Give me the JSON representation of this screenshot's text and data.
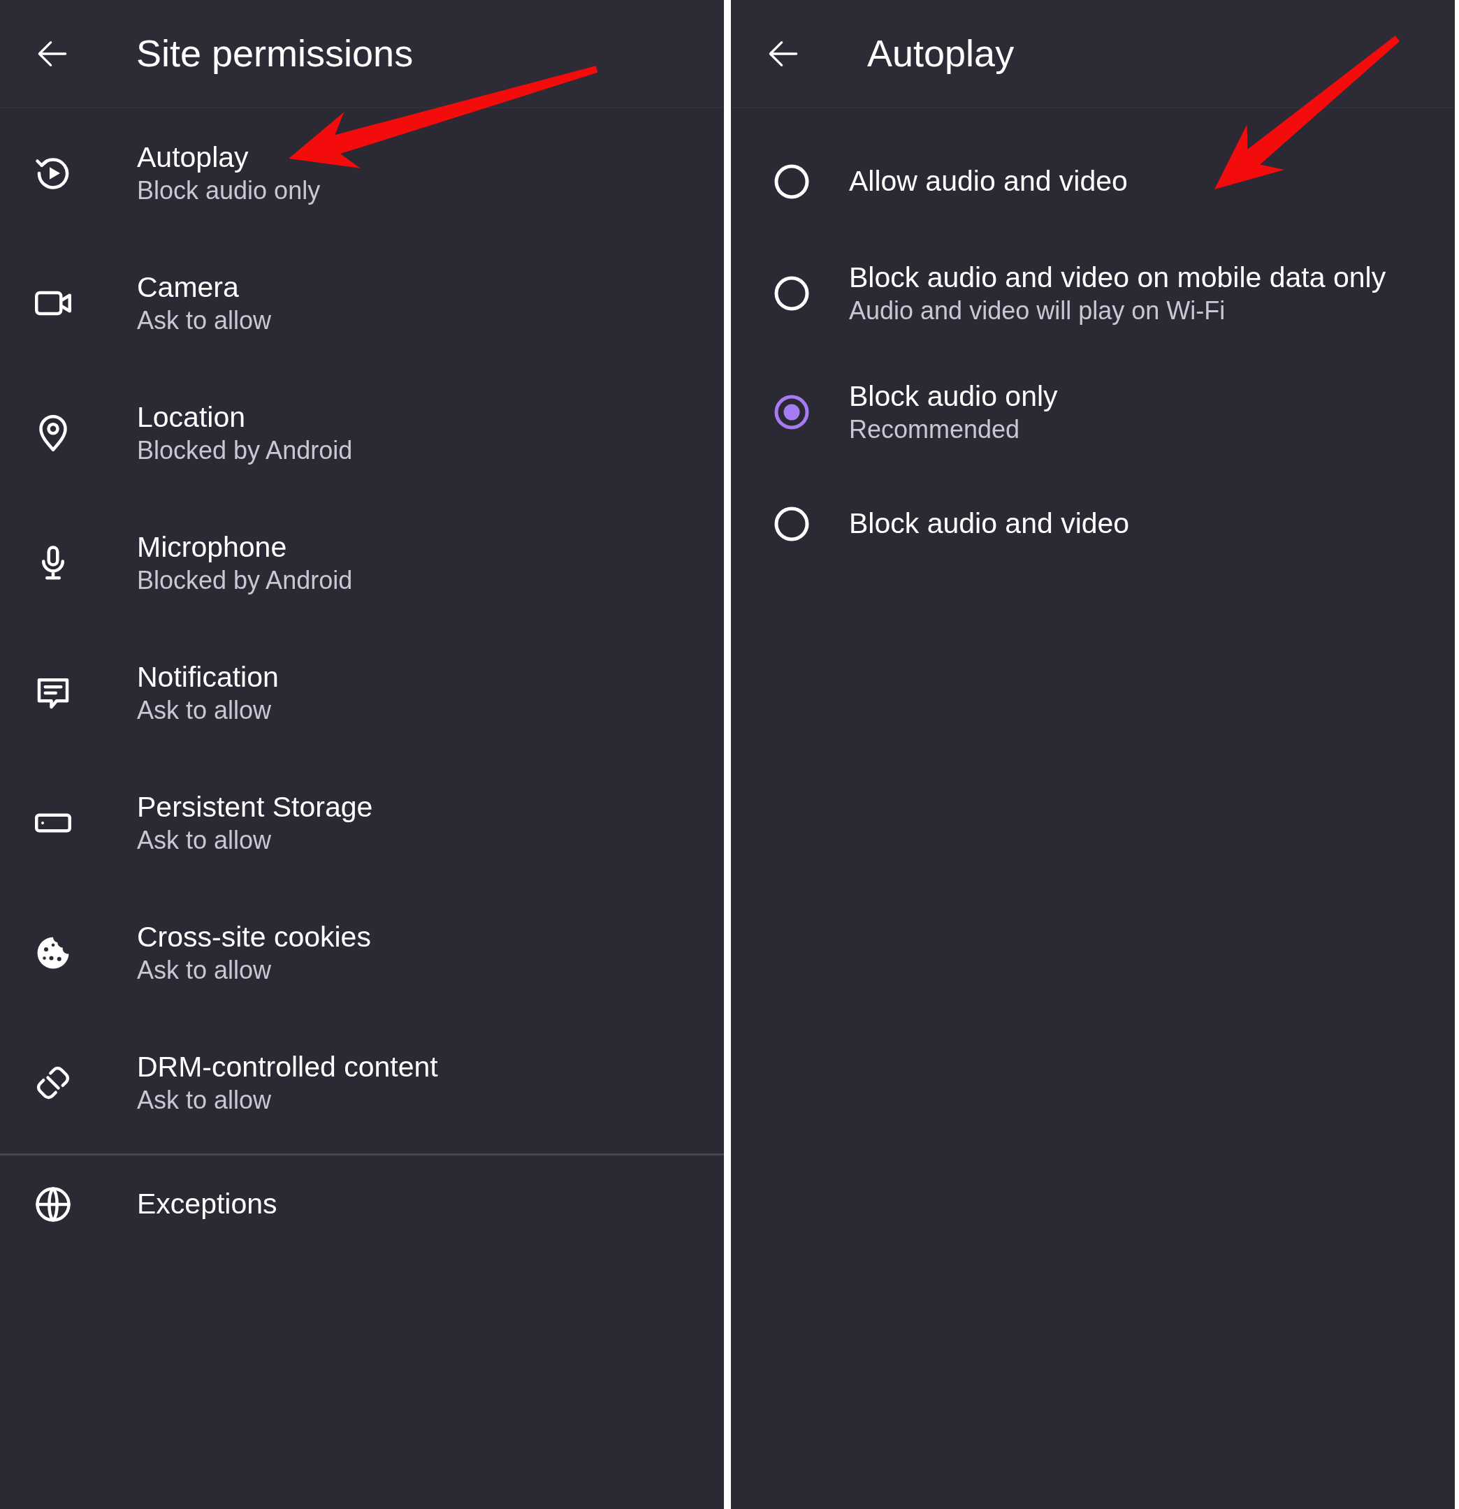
{
  "left_screen": {
    "title": "Site permissions",
    "items": [
      {
        "kind": "autoplay",
        "title": "Autoplay",
        "subtitle": "Block audio only"
      },
      {
        "kind": "camera",
        "title": "Camera",
        "subtitle": "Ask to allow"
      },
      {
        "kind": "location",
        "title": "Location",
        "subtitle": "Blocked by Android"
      },
      {
        "kind": "microphone",
        "title": "Microphone",
        "subtitle": "Blocked by Android"
      },
      {
        "kind": "notification",
        "title": "Notification",
        "subtitle": "Ask to allow"
      },
      {
        "kind": "storage",
        "title": "Persistent Storage",
        "subtitle": "Ask to allow"
      },
      {
        "kind": "cookies",
        "title": "Cross-site cookies",
        "subtitle": "Ask to allow"
      },
      {
        "kind": "drm",
        "title": "DRM-controlled content",
        "subtitle": "Ask to allow"
      }
    ],
    "exceptions": {
      "kind": "globe",
      "title": "Exceptions"
    }
  },
  "right_screen": {
    "title": "Autoplay",
    "options": [
      {
        "label": "Allow audio and video",
        "selected": false
      },
      {
        "label": "Block audio and video on mobile data only",
        "description": "Audio and video will play on Wi-Fi",
        "selected": false
      },
      {
        "label": "Block audio only",
        "description": "Recommended",
        "selected": true
      },
      {
        "label": "Block audio and video",
        "selected": false
      }
    ]
  }
}
